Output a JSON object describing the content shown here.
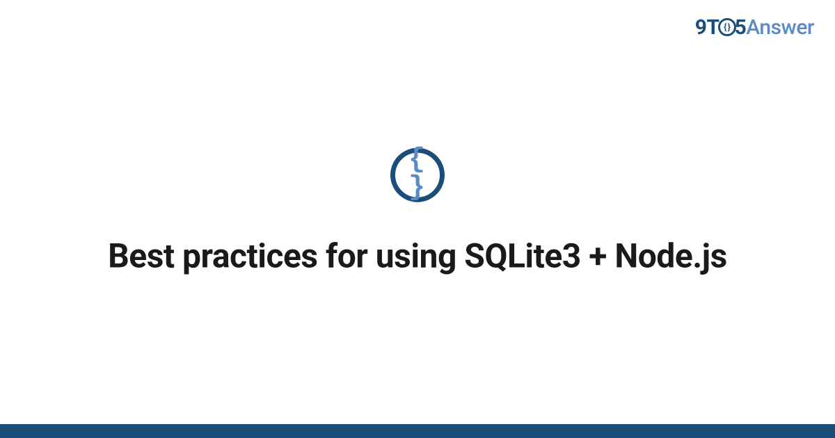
{
  "brand": {
    "part1": "9T",
    "circle_inner": "{ }",
    "part2": "5",
    "part3": "Answer"
  },
  "icon": {
    "glyph": "{ }"
  },
  "title": "Best practices for using SQLite3 + Node.js",
  "colors": {
    "primary_dark": "#1a4d7a",
    "primary_light": "#5a8bc4",
    "text": "#1a1a1a"
  }
}
